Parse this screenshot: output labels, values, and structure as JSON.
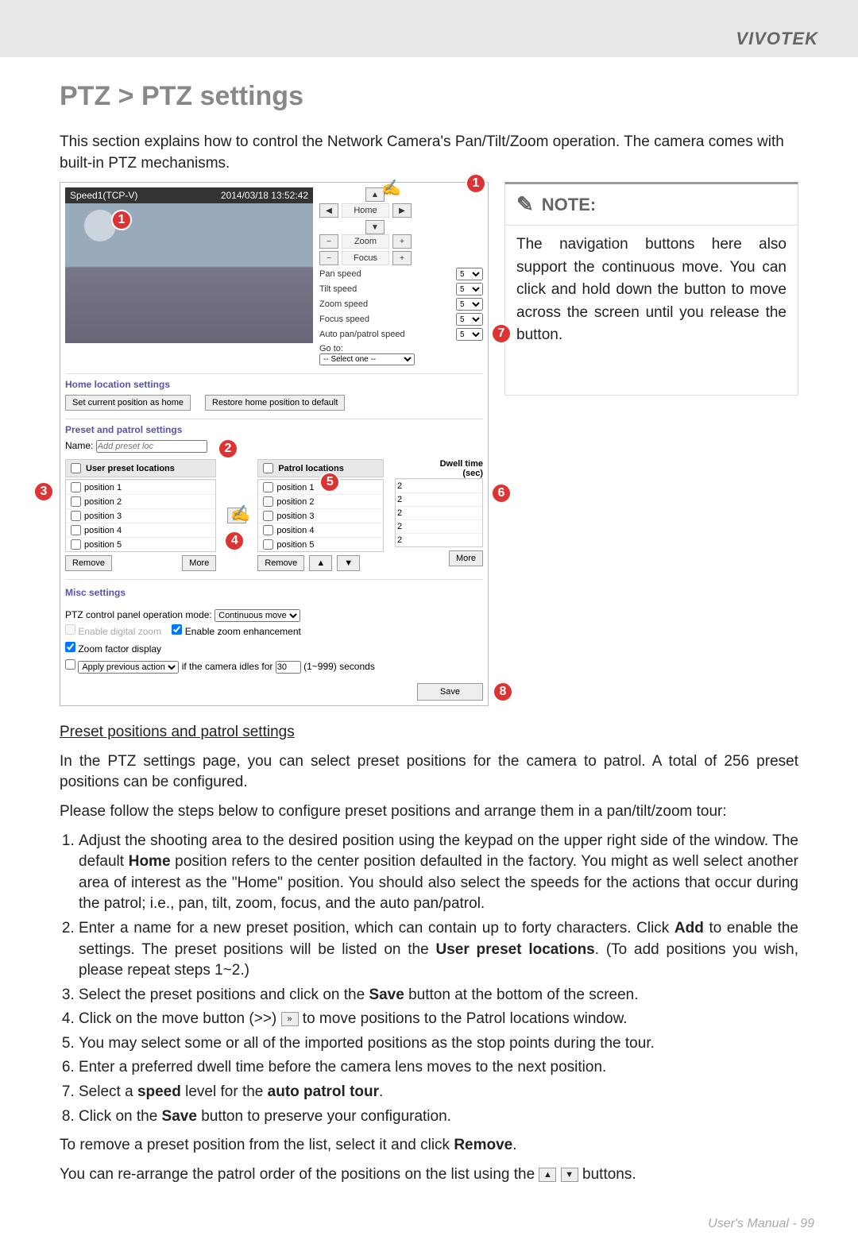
{
  "brand": "VIVOTEK",
  "heading": "PTZ > PTZ settings",
  "intro": "This section explains how to control the Network Camera's Pan/Tilt/Zoom operation. The camera comes with built-in PTZ mechanisms.",
  "ui": {
    "stream_label": "Speed1(TCP-V)",
    "timestamp": "2014/03/18 13:52:42",
    "nav": {
      "home": "Home",
      "zoom": "Zoom",
      "focus": "Focus"
    },
    "speeds": {
      "pan": {
        "label": "Pan speed",
        "value": "5"
      },
      "tilt": {
        "label": "Tilt speed",
        "value": "5"
      },
      "zoom": {
        "label": "Zoom speed",
        "value": "5"
      },
      "focus": {
        "label": "Focus speed",
        "value": "5"
      },
      "auto": {
        "label": "Auto pan/patrol speed",
        "value": "5"
      }
    },
    "goto": {
      "label": "Go to:",
      "option": "-- Select one --"
    },
    "home_section": {
      "title": "Home location settings",
      "set_btn": "Set current position as home",
      "restore_btn": "Restore home position to default"
    },
    "preset_section": {
      "title": "Preset and patrol settings",
      "name_label": "Name:",
      "name_placeholder": "Add preset loc",
      "user_col": "User preset locations",
      "patrol_col": "Patrol locations",
      "dwell_col1": "Dwell time",
      "dwell_col2": "(sec)",
      "positions": [
        "position 1",
        "position 2",
        "position 3",
        "position 4",
        "position 5"
      ],
      "dwell_vals": [
        "2",
        "2",
        "2",
        "2",
        "2"
      ],
      "remove": "Remove",
      "more": "More"
    },
    "misc": {
      "title": "Misc settings",
      "mode_label": "PTZ control panel operation mode:",
      "mode_value": "Continuous move",
      "enable_digital": "Enable digital zoom",
      "enable_enhance": "Enable zoom enhancement",
      "zoom_factor": "Zoom factor display",
      "apply_prev": "Apply previous action",
      "idle_label": "if the camera idles for",
      "idle_value": "30",
      "idle_unit": "(1~999) seconds"
    },
    "save": "Save"
  },
  "callouts": {
    "c1": "1",
    "c2": "2",
    "c3": "3",
    "c4": "4",
    "c5": "5",
    "c6": "6",
    "c7": "7",
    "c8": "8"
  },
  "note": {
    "title": "NOTE:",
    "body": "The navigation buttons here also support the continuous move. You can click and hold down the button to move across the screen until you release the button."
  },
  "article": {
    "sub1": "Preset positions and patrol settings",
    "p1": "In the PTZ settings page, you can select preset positions for the camera to patrol. A total of 256 preset positions can be configured.",
    "p2": "Please follow the steps below to configure preset positions and arrange them in a pan/tilt/zoom tour:",
    "li1a": "Adjust the shooting area to the desired position using the keypad on the upper right side of the window. The default ",
    "li1b": "Home",
    "li1c": " position refers to the center position defaulted in the factory. You might as well select another area of interest as the \"Home\" position. You should also select the speeds for the actions that occur during the patrol; i.e., pan, tilt, zoom, focus, and the auto pan/patrol.",
    "li2a": "Enter a name for a new preset position, which can contain up to forty characters. Click ",
    "li2b": "Add",
    "li2c": " to enable the settings. The preset positions will be listed on the ",
    "li2d": "User preset locations",
    "li2e": ". (To add positions you wish, please repeat steps 1~2.)",
    "li3a": "Select the preset positions and click on the ",
    "li3b": "Save",
    "li3c": " button at the bottom of the screen.",
    "li4": "Click on the move button (>>)        to move positions to the Patrol locations window.",
    "li5": "You may select some or all of the imported positions as the stop points during the tour.",
    "li6": "Enter a preferred dwell time before the camera lens moves to the next position.",
    "li7a": "Select a ",
    "li7b": "speed",
    "li7c": " level for the ",
    "li7d": "auto patrol tour",
    "li7e": ".",
    "li8a": "Click on the ",
    "li8b": "Save",
    "li8c": " button to preserve your configuration.",
    "p3a": "To remove a preset position from the list, select it and click ",
    "p3b": "Remove",
    "p3c": ".",
    "p4": "You can re-arrange the patrol order of the positions on the list using the            buttons."
  },
  "footer": {
    "label": "User's Manual - ",
    "page": "99"
  }
}
